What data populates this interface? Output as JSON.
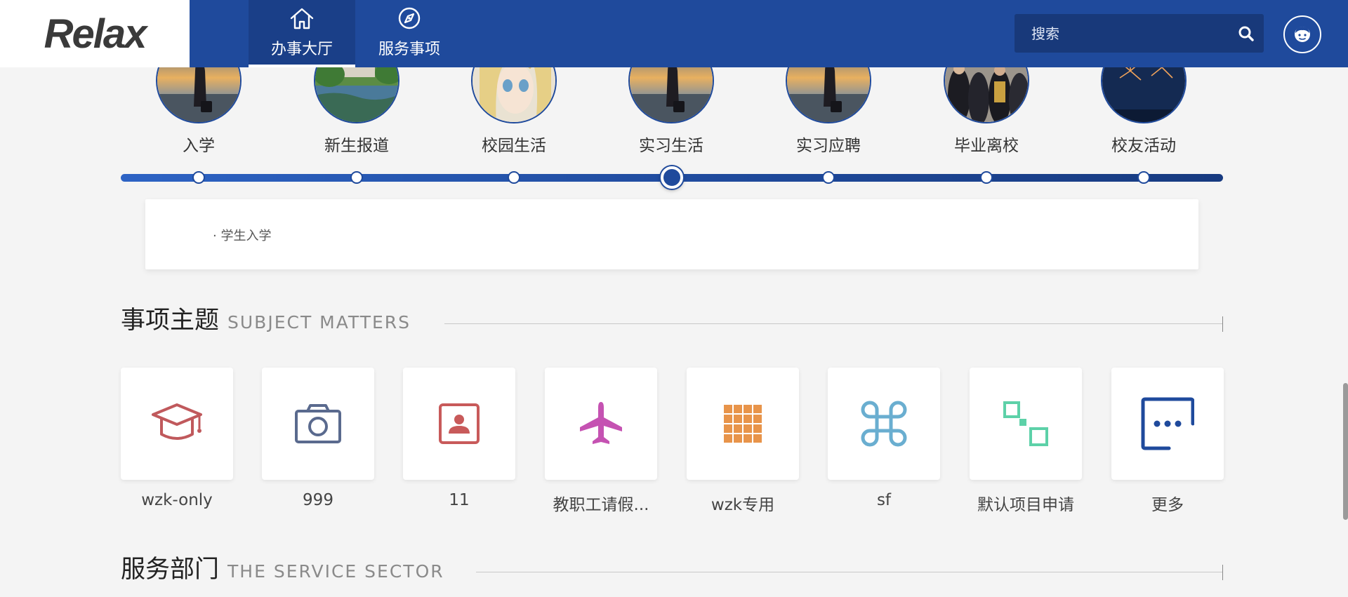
{
  "header": {
    "logo_text": "Relax",
    "nav": [
      {
        "label": "办事大厅",
        "icon": "home-icon",
        "active": true
      },
      {
        "label": "服务事项",
        "icon": "compass-icon",
        "active": false
      }
    ],
    "search": {
      "placeholder": "搜索",
      "value": ""
    },
    "brand_color": "#1f4a9c"
  },
  "timeline": {
    "stages": [
      {
        "label": "入学",
        "photo": "sunset-traveler-photo"
      },
      {
        "label": "新生报道",
        "photo": "campus-lake-photo"
      },
      {
        "label": "校园生活",
        "photo": "anime-girl-photo"
      },
      {
        "label": "实习生活",
        "photo": "sunset-traveler-photo",
        "active": true
      },
      {
        "label": "实习应聘",
        "photo": "sunset-traveler-photo"
      },
      {
        "label": "毕业离校",
        "photo": "graduation-crowd-photo"
      },
      {
        "label": "校友活动",
        "photo": "fireworks-photo"
      }
    ],
    "detail_items": [
      "· 学生入学"
    ]
  },
  "subject_section": {
    "title_cn": "事项主题",
    "title_en": "SUBJECT MATTERS",
    "tiles": [
      {
        "label": "wzk-only",
        "icon": "graduation-cap-icon",
        "color": "#c0595c"
      },
      {
        "label": "999",
        "icon": "camera-icon",
        "color": "#5a6a8e"
      },
      {
        "label": "11",
        "icon": "contact-card-icon",
        "color": "#c85a5a"
      },
      {
        "label": "教职工请假...",
        "icon": "airplane-icon",
        "color": "#c552b2"
      },
      {
        "label": "wzk专用",
        "icon": "grid-icon",
        "color": "#e8944a"
      },
      {
        "label": "sf",
        "icon": "command-icon",
        "color": "#6aaed0"
      },
      {
        "label": "默认项目申请",
        "icon": "workflow-icon",
        "color": "#5dd1a8"
      },
      {
        "label": "更多",
        "icon": "more-icon",
        "color": "#1f4a9c"
      }
    ]
  },
  "service_section": {
    "title_cn": "服务部门",
    "title_en": "THE SERVICE SECTOR"
  }
}
